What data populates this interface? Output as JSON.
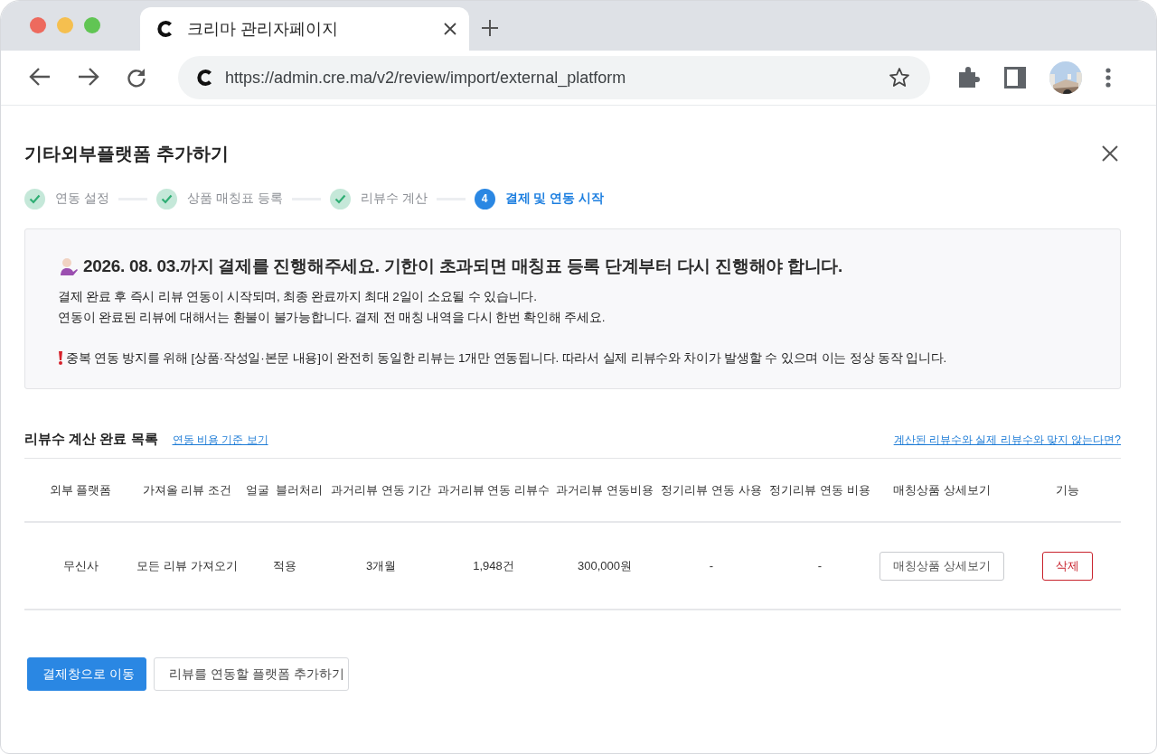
{
  "browser": {
    "tab": {
      "title": "크리마 관리자페이지"
    },
    "url": "https://admin.cre.ma/v2/review/import/external_platform"
  },
  "dialog": {
    "title": "기타외부플랫폼 추가하기"
  },
  "steps": [
    {
      "label": "연동 설정",
      "completed": true,
      "selected": false
    },
    {
      "label": "상품 매칭표 등록",
      "completed": true,
      "selected": false
    },
    {
      "label": "리뷰수 계산",
      "completed": true,
      "selected": false
    },
    {
      "label": "결제 및 연동 시작",
      "number": "4",
      "completed": false,
      "selected": true
    }
  ],
  "notice": {
    "heading": "2026. 08. 03.까지 결제를 진행해주세요. 기한이 초과되면 매칭표 등록 단계부터 다시 진행해야 합니다.",
    "lines": [
      "결제 완료 후 즉시 리뷰 연동이 시작되며, 최종 완료까지 최대 2일이 소요될 수 있습니다.",
      "연동이 완료된 리뷰에 대해서는 환불이 불가능합니다. 결제 전 매칭 내역을 다시 한번 확인해 주세요."
    ],
    "warning": "중복 연동 방지를 위해 [상품·작성일·본문 내용]이 완전히 동일한 리뷰는 1개만 연동됩니다. 따라서 실제 리뷰수와 차이가 발생할 수 있으며 이는 정상 동작 입니다."
  },
  "section": {
    "title": "리뷰수 계산 완료 목록",
    "link": "연동 비용 기준 보기",
    "help_link": "계산된 리뷰수와 실제 리뷰수와 맞지 않는다면?"
  },
  "table": {
    "columns": [
      "외부 플랫폼",
      "가져올 리뷰 조건",
      "얼굴  블러처리",
      "과거리뷰 연동 기간",
      "과거리뷰 연동 리뷰수",
      "과거리뷰 연동비용",
      "정기리뷰 연동 사용",
      "정기리뷰 연동 비용",
      "매칭상품 상세보기",
      "기능"
    ],
    "rows": [
      {
        "cells": [
          "무신사",
          "모든 리뷰 가져오기",
          "적용",
          "3개월",
          "1,948건",
          "300,000원",
          "-",
          "-"
        ],
        "detail_button": "매칭상품 상세보기",
        "delete_button": "삭제"
      }
    ]
  },
  "buttons": [
    {
      "label": "결제창으로 이동",
      "kind": "primary"
    },
    {
      "label": "리뷰를 연동할 플랫폼 추가하기",
      "kind": "secondary"
    }
  ]
}
